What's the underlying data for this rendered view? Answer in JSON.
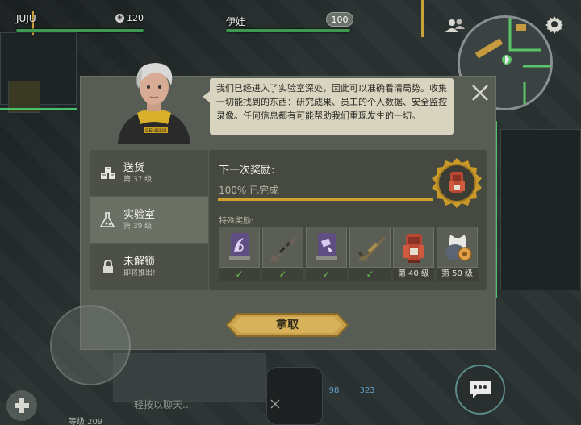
{
  "hud": {
    "player_name": "JUJU",
    "player_health": "120",
    "companion_name": "伊娃",
    "companion_health": "100"
  },
  "dialog": {
    "speech": "我们已经进入了实验室深处，因此可以准确看清局势。收集一切能找到的东西：研究成果、员工的个人数据、安全监控录像。任何信息都有可能帮助我们重现发生的一切。",
    "sidebar": [
      {
        "title": "送货",
        "sub": "第 37 级",
        "icon": "boxes-icon"
      },
      {
        "title": "实验室",
        "sub": "第 39 级",
        "icon": "flask-icon"
      },
      {
        "title": "未解锁",
        "sub": "即将推出!",
        "icon": "lock-icon"
      }
    ],
    "next_reward_title": "下一次奖励:",
    "progress_text": "100% 已完成",
    "progress": 1.0,
    "special_label": "特殊奖励:",
    "rewards": [
      {
        "icon": "research-card-icon",
        "footer": "✓"
      },
      {
        "icon": "rifle-icon",
        "footer": "✓"
      },
      {
        "icon": "research-card-icon",
        "footer": "✓"
      },
      {
        "icon": "shotgun-icon",
        "footer": "✓"
      },
      {
        "icon": "backpack-icon",
        "footer": "第 40 级"
      },
      {
        "icon": "armor-vest-icon",
        "footer": "第 50 级"
      }
    ],
    "claim_label": "拿取"
  },
  "chat": {
    "placeholder": "轻按以聊天..."
  },
  "bottom": {
    "level": "等级 209",
    "counter_left": "98",
    "counter_right": "323"
  },
  "colors": {
    "accent_gold": "#d4a12e",
    "check_green": "#62c24a",
    "hud_green": "#3d9a50"
  }
}
